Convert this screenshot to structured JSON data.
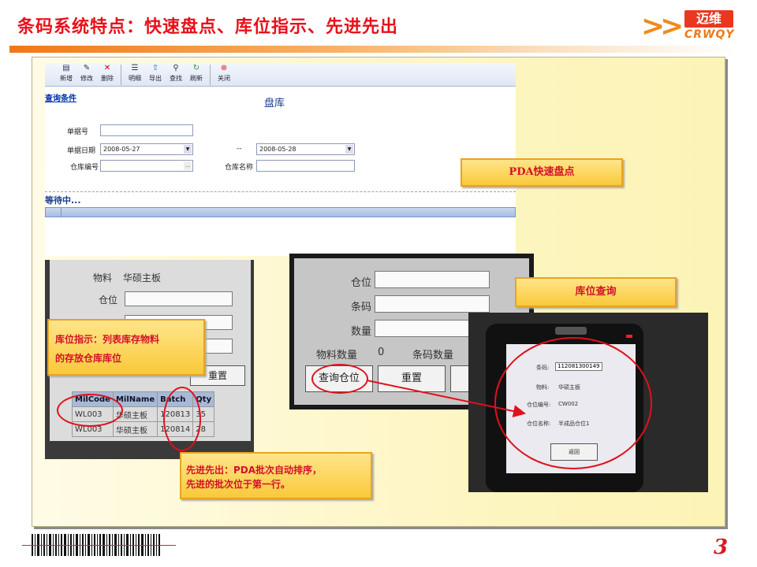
{
  "slide_title": "条码系统特点：快速盘点、库位指示、先进先出",
  "logo": {
    "cn": "迈维",
    "en": "CRWQY"
  },
  "toolbar": [
    {
      "icon": "new-icon",
      "glyph": "▤",
      "label": "新增"
    },
    {
      "icon": "edit-icon",
      "glyph": "✎",
      "label": "修改"
    },
    {
      "icon": "delete-icon",
      "glyph": "✕",
      "label": "删除"
    },
    {
      "icon": "detail-icon",
      "glyph": "☰",
      "label": "明细"
    },
    {
      "icon": "export-icon",
      "glyph": "⇧",
      "label": "导出"
    },
    {
      "icon": "search-icon",
      "glyph": "⚲",
      "label": "查找"
    },
    {
      "icon": "refresh-icon",
      "glyph": "↻",
      "label": "刷新"
    },
    {
      "icon": "close-icon",
      "glyph": "⊗",
      "label": "关闭"
    }
  ],
  "query_link": "查询条件",
  "page_heading": "盘库",
  "form": {
    "doc_no_label": "单据号",
    "doc_date_label": "单据日期",
    "date_from": "2008-05-27",
    "date_sep": "--",
    "date_to": "2008-05-28",
    "wh_code_label": "仓库编号",
    "wh_name_label": "仓库名称"
  },
  "waiting": "等待中...",
  "photo1": {
    "material_label": "物料",
    "material_value": "华硕主板",
    "location_label": "仓位",
    "reset_btn": "重置",
    "columns": [
      "MilCode",
      "MilName",
      "Batch",
      "Qty"
    ],
    "rows": [
      [
        "WL003",
        "华硕主板",
        "120813",
        "35"
      ],
      [
        "WL003",
        "华硕主板",
        "120814",
        "28"
      ]
    ]
  },
  "photo2": {
    "location_label": "仓位",
    "barcode_label": "条码",
    "qty_label": "数量",
    "material_qty_label": "物料数量",
    "material_qty_value": "0",
    "barcode_qty_label": "条码数量",
    "query_btn": "查询仓位",
    "reset_btn": "重置"
  },
  "photo3": {
    "barcode_label": "条码:",
    "barcode_value": "112081300149",
    "material_label": "物料:",
    "material_value": "华硕主板",
    "loc_code_label": "仓位编号:",
    "loc_code_value": "CW002",
    "loc_name_label": "仓位名称:",
    "loc_name_value": "半成品仓位1",
    "back_btn": "返回"
  },
  "callouts": {
    "pda_count": "PDA快速盘点",
    "loc_query": "库位查询",
    "loc_indicate_1": "库位指示：列表库存物料",
    "loc_indicate_2": "的存放仓库库位",
    "fifo_1": "先进先出：PDA批次自动排序，",
    "fifo_2": "先进的批次位于第一行。"
  },
  "page_number": "3",
  "colors": {
    "title": "#e8101a",
    "accent": "#f07818",
    "callout_text": "#d4102b",
    "highlight": "#e0111b"
  }
}
